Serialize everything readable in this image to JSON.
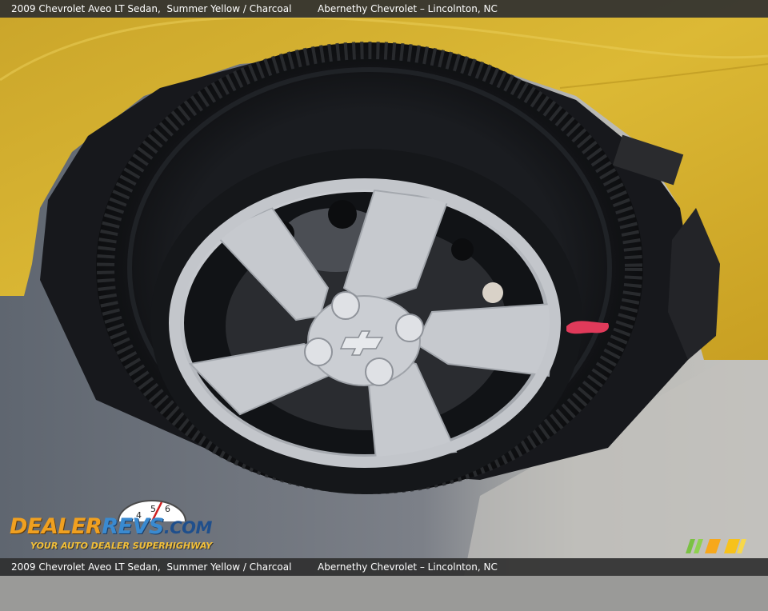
{
  "caption": {
    "vehicle": "2009 Chevrolet Aveo LT Sedan,  Summer Yellow / Charcoal",
    "dealer": "Abernethy Chevrolet – Lincolnton, NC"
  },
  "logo": {
    "word_part1": "DEALER",
    "word_part2": "REVS",
    "word_part3": ".COM",
    "tagline": "YOUR AUTO DEALER SUPERHIGHWAY",
    "gauge_digits": [
      "4",
      "5",
      "6"
    ]
  },
  "colors": {
    "car_paint": "#d8b22e",
    "tire": "#141518",
    "wheel_silver": "#c9cbcf",
    "pavement": "#9a9a98",
    "caption_bar": "#303030"
  }
}
